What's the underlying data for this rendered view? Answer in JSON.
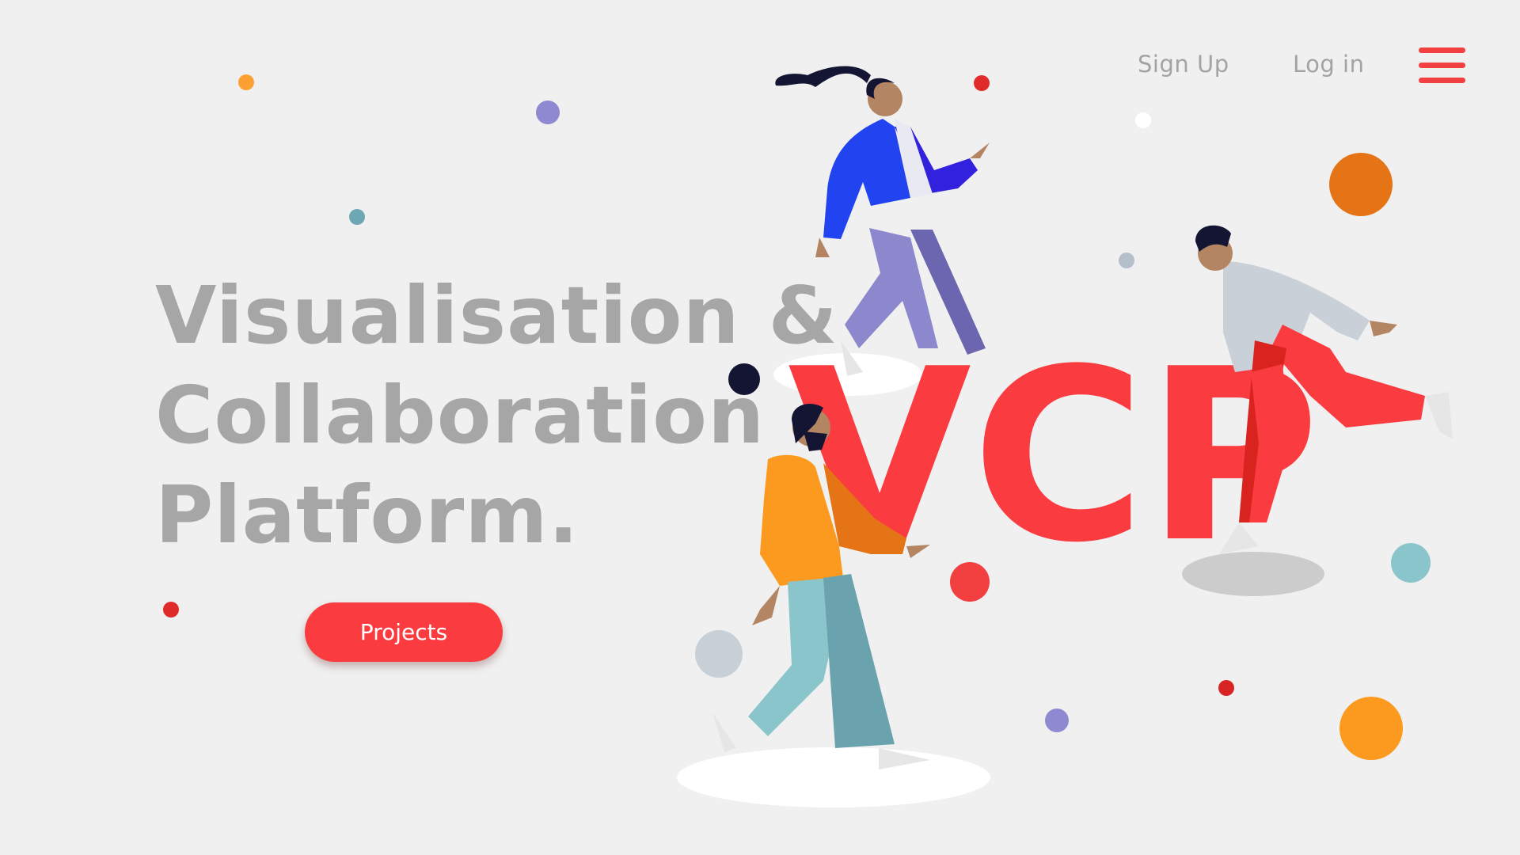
{
  "nav": {
    "signup_label": "Sign Up",
    "login_label": "Log in",
    "menu_icon": "hamburger-menu-icon"
  },
  "hero": {
    "title_lines": [
      "Visualisation &",
      "Collaboration",
      "Platform."
    ],
    "cta_label": "Projects"
  },
  "illustration": {
    "logo_text": "VCP",
    "figures": [
      "woman-walking-figure",
      "man-running-figure",
      "bearded-man-walking-figure"
    ]
  },
  "colors": {
    "background": "#f0f0f0",
    "accent_red": "#fa3c40",
    "heading_gray": "#a6a6a6",
    "nav_gray": "#a3a3a3"
  }
}
